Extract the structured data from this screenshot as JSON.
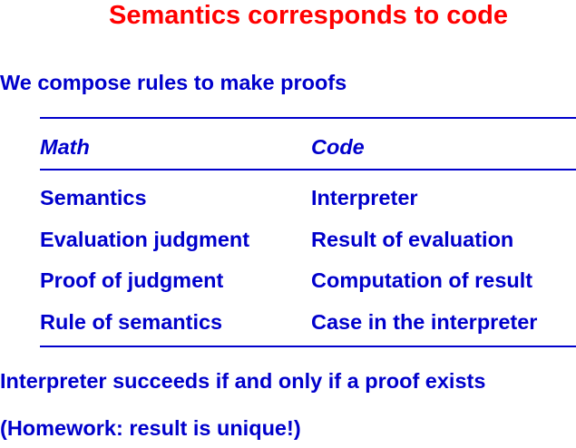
{
  "title": "Semantics corresponds to code",
  "intro": "We compose rules to make proofs",
  "table": {
    "headers": [
      "Math",
      "Code"
    ],
    "rows": [
      [
        "Semantics",
        "Interpreter"
      ],
      [
        "Evaluation judgment",
        "Result of evaluation"
      ],
      [
        "Proof of judgment",
        "Computation of result"
      ],
      [
        "Rule of semantics",
        "Case in the interpreter"
      ]
    ]
  },
  "conclusion": "Interpreter succeeds if and only if a proof exists",
  "homework": "(Homework: result is unique!)",
  "colors": {
    "title": "#ff0000",
    "body": "#0000cc"
  }
}
